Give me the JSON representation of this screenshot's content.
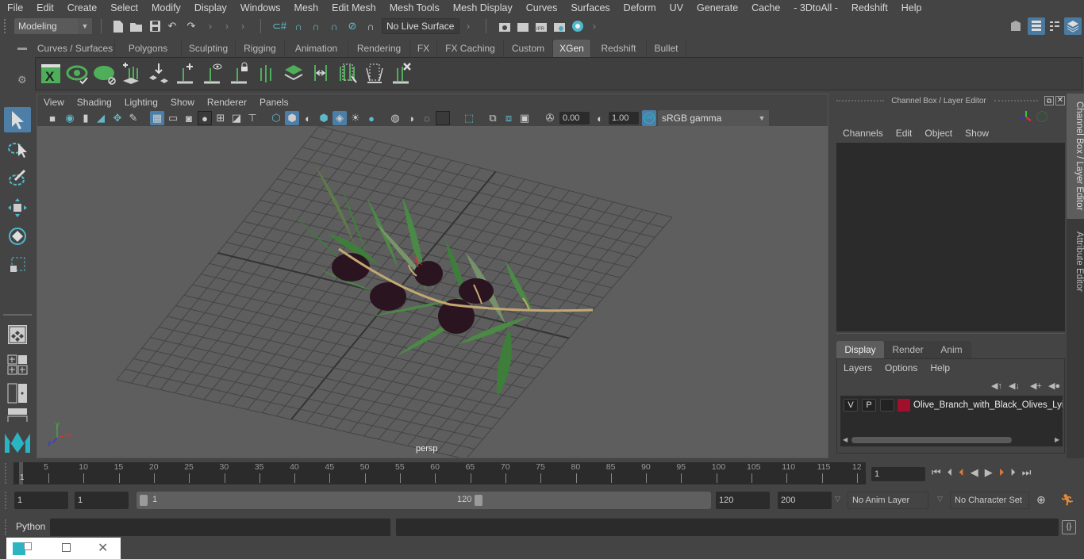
{
  "menubar": [
    "File",
    "Edit",
    "Create",
    "Select",
    "Modify",
    "Display",
    "Windows",
    "Mesh",
    "Edit Mesh",
    "Mesh Tools",
    "Mesh Display",
    "Curves",
    "Surfaces",
    "Deform",
    "UV",
    "Generate",
    "Cache",
    "- 3DtoAll -",
    "Redshift",
    "Help"
  ],
  "toolbar": {
    "mode_select": "Modeling",
    "live_surface": "No Live Surface"
  },
  "shelf": {
    "tabs": [
      "Curves / Surfaces",
      "Polygons",
      "Sculpting",
      "Rigging",
      "Animation",
      "Rendering",
      "FX",
      "FX Caching",
      "Custom",
      "XGen",
      "Redshift",
      "Bullet"
    ],
    "active_tab": "XGen",
    "icons": [
      "xgen-editor-icon",
      "preview-icon",
      "clear-preview-icon",
      "add-guides-icon",
      "place-guide-icon",
      "add-guide-icon",
      "toggle-guide-display-icon",
      "lock-guide-icon",
      "select-guides-icon",
      "description-icon",
      "flip-guides-icon",
      "interactive-groom-icon",
      "groom-editor-icon",
      "delete-guides-icon"
    ]
  },
  "viewport": {
    "menu": [
      "View",
      "Shading",
      "Lighting",
      "Show",
      "Renderer",
      "Panels"
    ],
    "exposure": "0.00",
    "gamma": "1.00",
    "color_management_badge": "ON",
    "color_space": "sRGB gamma",
    "camera_label": "persp",
    "axis_labels": {
      "x": "x",
      "y": "y",
      "z": "z"
    }
  },
  "channel_box": {
    "title": "Channel Box / Layer Editor",
    "menu": [
      "Channels",
      "Edit",
      "Object",
      "Show"
    ]
  },
  "layer_editor": {
    "tabs": [
      "Display",
      "Render",
      "Anim"
    ],
    "active_tab": "Display",
    "menu": [
      "Layers",
      "Options",
      "Help"
    ],
    "layers": [
      {
        "visible": "V",
        "playback": "P",
        "color": "#a0102a",
        "name": "Olive_Branch_with_Black_Olives_Lying"
      }
    ]
  },
  "side_tabs": [
    "Channel Box / Layer Editor",
    "Attribute Editor"
  ],
  "timeline": {
    "start_marker": "1",
    "ticks": [
      "5",
      "10",
      "15",
      "20",
      "25",
      "30",
      "35",
      "40",
      "45",
      "50",
      "55",
      "60",
      "65",
      "70",
      "75",
      "80",
      "85",
      "90",
      "95",
      "100",
      "105",
      "110",
      "115",
      "12"
    ],
    "current_frame": "1"
  },
  "range": {
    "start": "1",
    "playback_start": "1",
    "slider_start": "1",
    "slider_end": "120",
    "playback_end": "120",
    "end": "200",
    "anim_layer": "No Anim Layer",
    "character_set": "No Character Set"
  },
  "command_line": {
    "label": "Python"
  }
}
